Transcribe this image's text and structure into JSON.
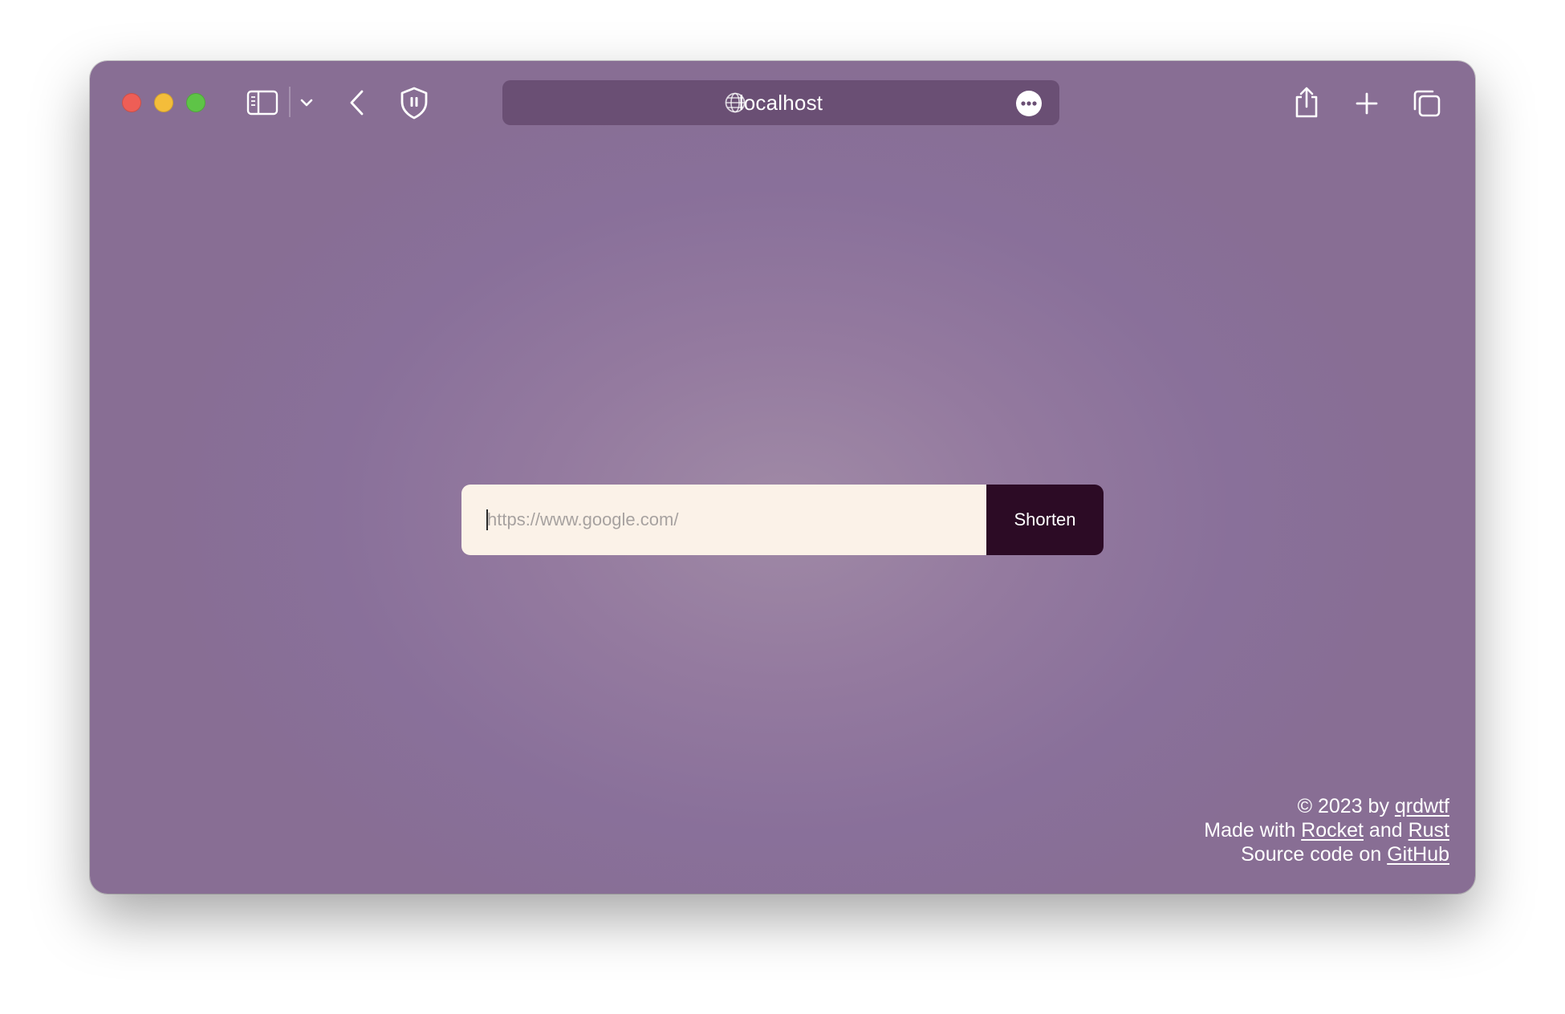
{
  "browser": {
    "address": "localhost",
    "icons": {
      "sidebar": "sidebar-icon",
      "tab_menu": "chevron-down-icon",
      "back": "chevron-left-icon",
      "privacy": "shield-icon",
      "site": "globe-icon",
      "page_menu": "ellipsis-icon",
      "share": "share-icon",
      "new_tab": "plus-icon",
      "tab_overview": "tabs-overview-icon"
    }
  },
  "shortener": {
    "input_value": "",
    "input_placeholder": "https://www.google.com/",
    "button_label": "Shorten"
  },
  "footer": {
    "line1_prefix": "© 2023 by ",
    "author_link": "qrdwtf",
    "line2_prefix": "Made with ",
    "rocket_link": "Rocket",
    "line2_middle": " and ",
    "rust_link": "Rust",
    "line3_prefix": "Source code on ",
    "github_link": "GitHub"
  },
  "colors": {
    "page_background": "#896f98",
    "page_glow": "#a08aa6",
    "input_background": "#fbf2e8",
    "button_background": "#2c0b25",
    "address_bar": "#6a4f74"
  }
}
